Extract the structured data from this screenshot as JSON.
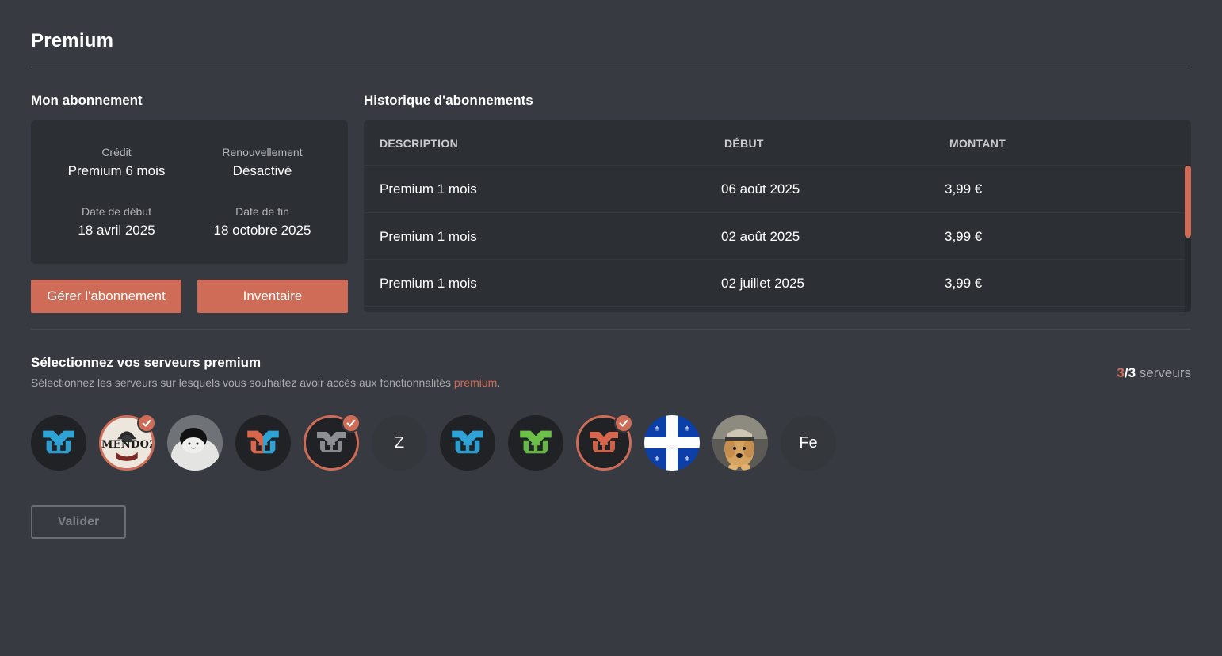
{
  "page": {
    "title": "Premium"
  },
  "subscription": {
    "section_title": "Mon abonnement",
    "credit_label": "Crédit",
    "credit_value": "Premium 6 mois",
    "renewal_label": "Renouvellement",
    "renewal_value": "Désactivé",
    "start_label": "Date de début",
    "start_value": "18 avril 2025",
    "end_label": "Date de fin",
    "end_value": "18 octobre 2025",
    "manage_button": "Gérer l'abonnement",
    "inventory_button": "Inventaire"
  },
  "history": {
    "section_title": "Historique d'abonnements",
    "columns": [
      "DESCRIPTION",
      "DÉBUT",
      "MONTANT"
    ],
    "rows": [
      {
        "description": "Premium 1 mois",
        "start": "06 août 2025",
        "amount": "3,99 €"
      },
      {
        "description": "Premium 1 mois",
        "start": "02 août 2025",
        "amount": "3,99 €"
      },
      {
        "description": "Premium 1 mois",
        "start": "02 juillet 2025",
        "amount": "3,99 €"
      }
    ]
  },
  "servers": {
    "section_title": "Sélectionnez vos serveurs premium",
    "subtitle_before": "Sélectionnez les serveurs sur lesquels vous souhaitez avoir accès aux fonctionnalités ",
    "subtitle_accent": "premium",
    "subtitle_after": ".",
    "count_selected": "3",
    "count_sep": "/",
    "count_total": "3",
    "count_suffix": " serveurs",
    "items": [
      {
        "icon": "logo-blue-icon",
        "selected": false
      },
      {
        "icon": "mendoza-avatar",
        "selected": true,
        "text": "MENDOZA"
      },
      {
        "icon": "plush-avatar",
        "selected": false
      },
      {
        "icon": "logo-orange-blue-icon",
        "selected": false
      },
      {
        "icon": "logo-gray-icon",
        "selected": true
      },
      {
        "icon": "letter-avatar",
        "selected": false,
        "text": "Z"
      },
      {
        "icon": "logo-blue-icon",
        "selected": false
      },
      {
        "icon": "logo-green-icon",
        "selected": false
      },
      {
        "icon": "logo-red-icon",
        "selected": true
      },
      {
        "icon": "quebec-flag-avatar",
        "selected": false
      },
      {
        "icon": "dog-avatar",
        "selected": false
      },
      {
        "icon": "letter-avatar",
        "selected": false,
        "text": "Fe"
      }
    ],
    "validate_button": "Valider"
  },
  "colors": {
    "background": "#373a40",
    "card": "#2c2f34",
    "accent": "#cf6c57",
    "logo_blue": "#2fa3d6",
    "logo_green": "#6cc04a",
    "logo_gray": "#8c8f94",
    "logo_orange": "#d7664d"
  }
}
